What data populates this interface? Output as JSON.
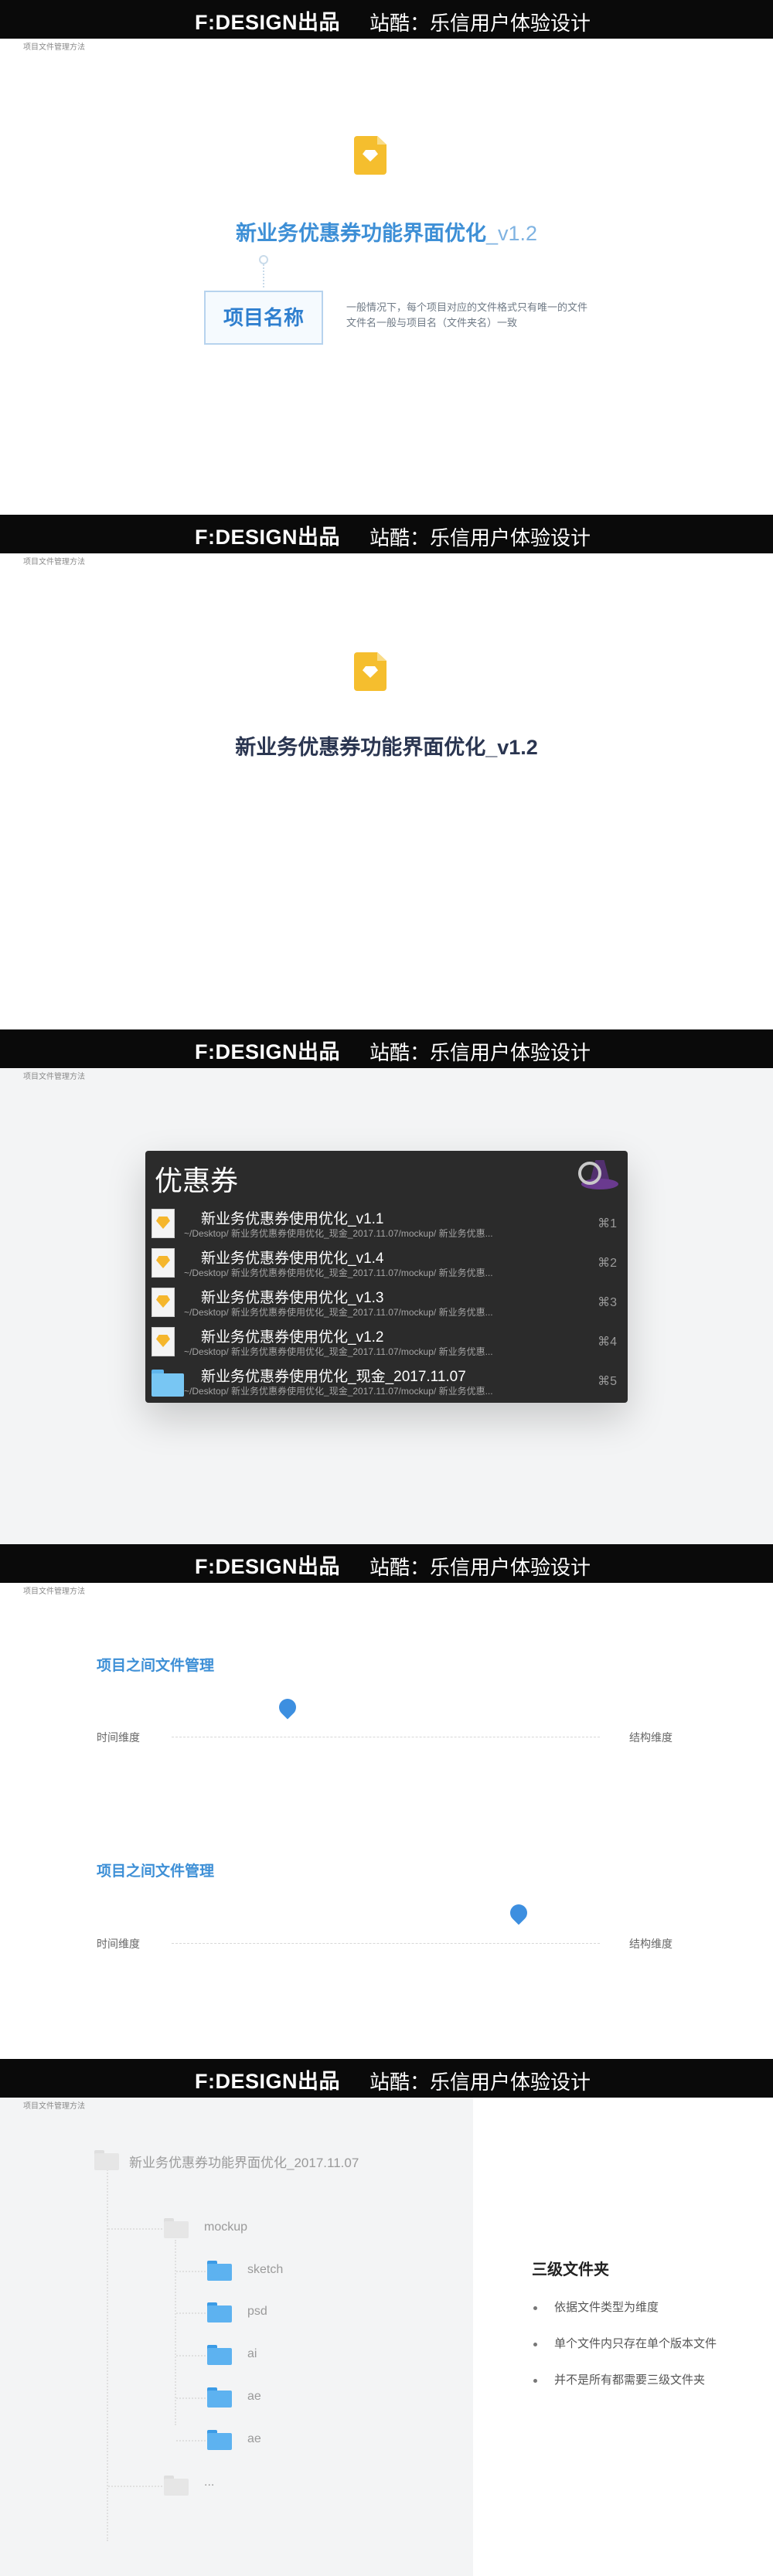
{
  "header": {
    "brand": "F:DESIGN出品",
    "byline": "站酷：乐信用户体验设计",
    "breadcrumb": "项目文件管理方法"
  },
  "panel1": {
    "icon": "sketch-file-icon",
    "title_main": "新业务优惠券功能界面优化",
    "title_version": "_v1.2",
    "label_box": "项目名称",
    "note_line1": "一般情况下，每个项目对应的文件格式只有唯一的文件",
    "note_line2": "文件名一般与项目名（文件夹名）一致"
  },
  "panel2": {
    "icon": "sketch-file-icon",
    "title": "新业务优惠券功能界面优化_v1.2"
  },
  "panel3": {
    "query": "优惠券",
    "app_icon": "alfred-hat-icon",
    "results": [
      {
        "title": "新业务优惠券使用优化_v1.1",
        "path": "~/Desktop/ 新业务优惠券使用优化_现金_2017.11.07/mockup/ 新业务优惠...",
        "shortcut": "⌘1",
        "icon": "sketch-file-icon"
      },
      {
        "title": "新业务优惠券使用优化_v1.4",
        "path": "~/Desktop/ 新业务优惠券使用优化_现金_2017.11.07/mockup/ 新业务优惠...",
        "shortcut": "⌘2",
        "icon": "sketch-file-icon"
      },
      {
        "title": "新业务优惠券使用优化_v1.3",
        "path": "~/Desktop/ 新业务优惠券使用优化_现金_2017.11.07/mockup/ 新业务优惠...",
        "shortcut": "⌘3",
        "icon": "sketch-file-icon"
      },
      {
        "title": "新业务优惠券使用优化_v1.2",
        "path": "~/Desktop/ 新业务优惠券使用优化_现金_2017.11.07/mockup/ 新业务优惠...",
        "shortcut": "⌘4",
        "icon": "sketch-file-icon"
      },
      {
        "title": "新业务优惠券使用优化_现金_2017.11.07",
        "path": "~/Desktop/ 新业务优惠券使用优化_现金_2017.11.07/mockup/ 新业务优惠...",
        "shortcut": "⌘5",
        "icon": "folder-icon"
      }
    ]
  },
  "panel4": {
    "timelines": [
      {
        "title": "项目之间文件管理",
        "left_label": "时间维度",
        "right_label": "结构维度",
        "marker_position": 0.27
      },
      {
        "title": "项目之间文件管理",
        "left_label": "时间维度",
        "right_label": "结构维度",
        "marker_position": 0.81
      }
    ]
  },
  "panel5": {
    "root": "新业务优惠券功能界面优化_2017.11.07",
    "level2": "mockup",
    "level3": [
      "sketch",
      "psd",
      "ai",
      "ae",
      "ae"
    ],
    "more": "...",
    "side_title": "三级文件夹",
    "side_items": [
      "依据文件类型为维度",
      "单个文件内只存在单个版本文件",
      "并不是所有都需要三级文件夹"
    ]
  },
  "colors": {
    "accent_blue": "#3d8fd6",
    "header_black": "#0a0a0a",
    "alfred_bg": "#2b2b2b",
    "sketch_yellow": "#f5be2e",
    "folder_blue": "#5db2f0"
  }
}
